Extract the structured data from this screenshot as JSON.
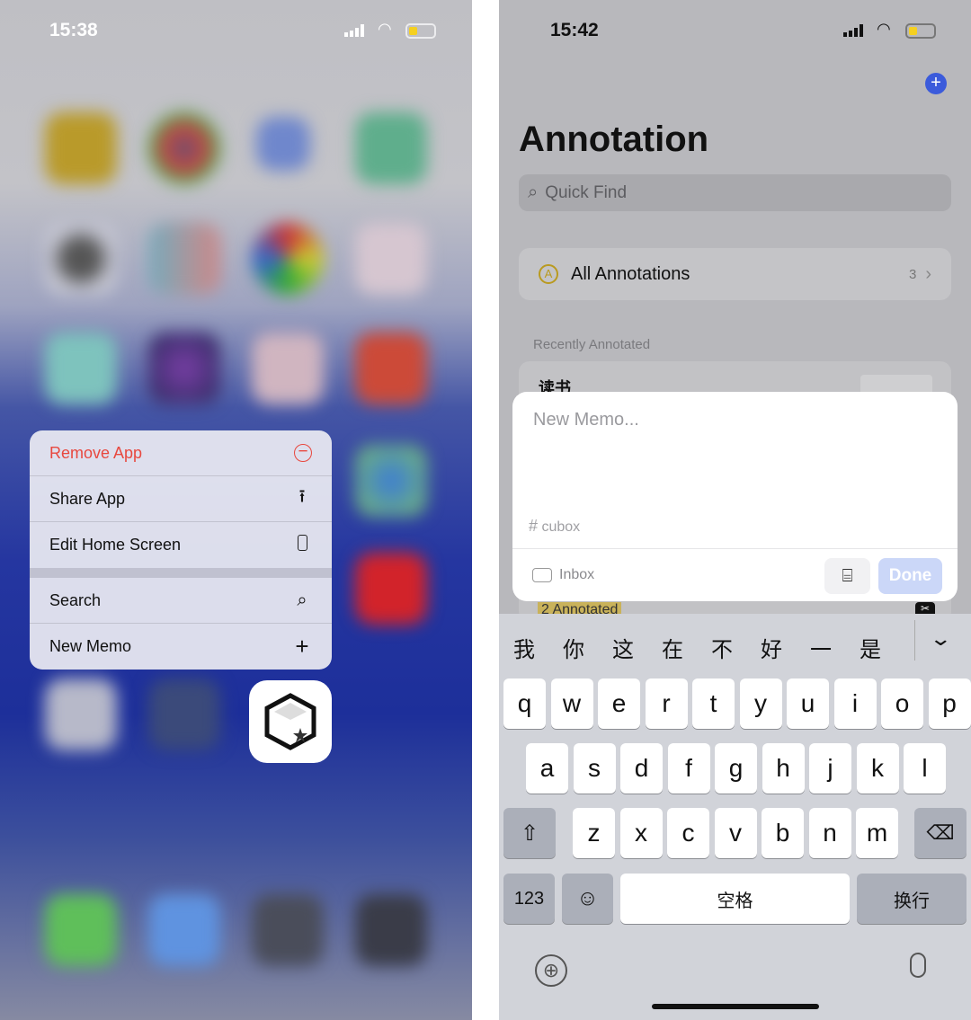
{
  "left": {
    "status": {
      "time": "15:38"
    },
    "context_menu": {
      "items": [
        {
          "label": "Remove App",
          "icon": "minus-circle-icon",
          "color": "#e8483f"
        },
        {
          "label": "Share App",
          "icon": "share-icon"
        },
        {
          "label": "Edit Home Screen",
          "icon": "phone-icon"
        },
        {
          "label": "Search",
          "icon": "search-icon"
        },
        {
          "label": "New Memo",
          "icon": "plus-icon"
        }
      ]
    },
    "app_icon": "cubox-app-icon"
  },
  "right": {
    "status": {
      "time": "15:42"
    },
    "title": "Annotation",
    "search": {
      "placeholder": "Quick Find"
    },
    "all_annotations": {
      "label": "All Annotations",
      "count": "3"
    },
    "section_header": "Recently Annotated",
    "recent_item": {
      "title": "读书",
      "badge": "2 Annotated"
    },
    "memo": {
      "placeholder": "New Memo...",
      "tag": "cubox",
      "folder": "Inbox",
      "done": "Done"
    },
    "accent": "#3b5bdb",
    "keyboard": {
      "candidates": [
        "我",
        "你",
        "这",
        "在",
        "不",
        "好",
        "一",
        "是"
      ],
      "row1": [
        "q",
        "w",
        "e",
        "r",
        "t",
        "y",
        "u",
        "i",
        "o",
        "p"
      ],
      "row2": [
        "a",
        "s",
        "d",
        "f",
        "g",
        "h",
        "j",
        "k",
        "l"
      ],
      "row3": [
        "z",
        "x",
        "c",
        "v",
        "b",
        "n",
        "m"
      ],
      "numbers": "123",
      "space": "空格",
      "return": "换行"
    }
  }
}
